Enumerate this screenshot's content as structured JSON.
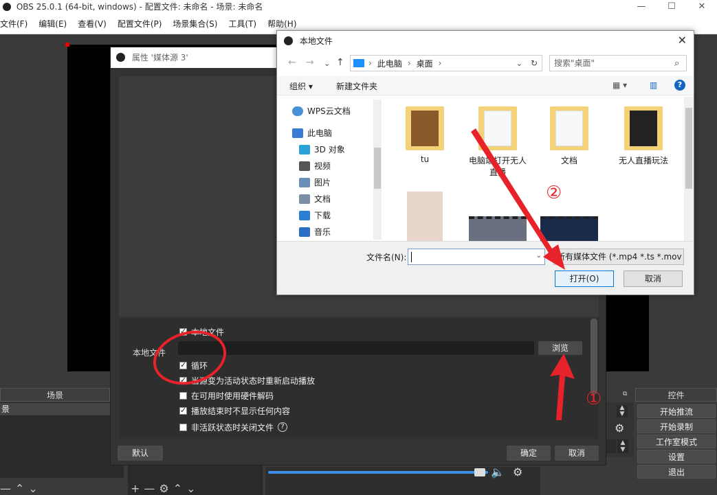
{
  "obs": {
    "title": "OBS 25.0.1 (64-bit, windows) - 配置文件: 未命名 - 场景: 未命名",
    "menu": [
      "文件(F)",
      "编辑(E)",
      "查看(V)",
      "配置文件(P)",
      "场景集合(S)",
      "工具(T)",
      "帮助(H)"
    ],
    "docks": {
      "scenes": "场景",
      "controls": "控件"
    },
    "scene_item": "景",
    "controls": [
      "开始推流",
      "开始录制",
      "工作室模式",
      "设置",
      "退出"
    ]
  },
  "properties": {
    "title": "属性 '媒体源 3'",
    "local_file_check": "本地文件",
    "local_file_label": "本地文件",
    "browse": "浏览",
    "checks": [
      {
        "label": "循环",
        "checked": true
      },
      {
        "label": "当源变为活动状态时重新启动播放",
        "checked": true
      },
      {
        "label": "在可用时使用硬件解码",
        "checked": false
      },
      {
        "label": "播放结束时不显示任何内容",
        "checked": true
      },
      {
        "label": "非活跃状态时关闭文件",
        "checked": false
      }
    ],
    "defaults": "默认",
    "ok": "确定",
    "cancel": "取消"
  },
  "file_dialog": {
    "title": "本地文件",
    "path": [
      "此电脑",
      "桌面"
    ],
    "search_placeholder": "搜索\"桌面\"",
    "organize": "组织 ▾",
    "new_folder": "新建文件夹",
    "tree": [
      {
        "label": "WPS云文档",
        "icon": "cloud-icon",
        "color": "#4a90d9"
      },
      {
        "label": "此电脑",
        "icon": "computer-icon",
        "color": "#3a7bd5"
      },
      {
        "label": "3D 对象",
        "icon": "cube-icon",
        "color": "#29a3d6"
      },
      {
        "label": "视频",
        "icon": "video-icon",
        "color": "#555555"
      },
      {
        "label": "图片",
        "icon": "picture-icon",
        "color": "#6a8fb5"
      },
      {
        "label": "文档",
        "icon": "document-icon",
        "color": "#7a8fa5"
      },
      {
        "label": "下载",
        "icon": "download-icon",
        "color": "#2a7fd4"
      },
      {
        "label": "音乐",
        "icon": "music-icon",
        "color": "#2a6fc4"
      }
    ],
    "files": [
      "tu",
      "电脑端打开无人直播",
      "文档",
      "无人直播玩法"
    ],
    "filename_label": "文件名(N):",
    "filename_value": "",
    "file_type": "所有媒体文件 (*.mp4 *.ts *.mov",
    "open": "打开(O)",
    "cancel": "取消"
  },
  "annotations": {
    "num1": "①",
    "num2": "②"
  }
}
